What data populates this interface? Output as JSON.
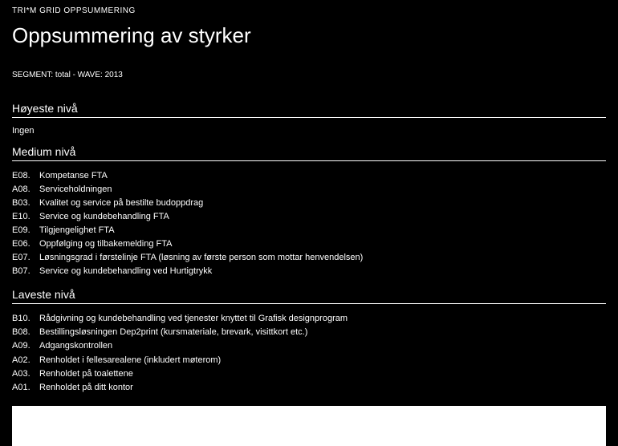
{
  "kicker": "TRI*M GRID OPPSUMMERING",
  "title": "Oppsummering av styrker",
  "segment": "SEGMENT: total - WAVE: 2013",
  "sections": {
    "high": {
      "heading": "Høyeste nivå",
      "none": "Ingen"
    },
    "medium": {
      "heading": "Medium nivå",
      "items": [
        {
          "code": "E08",
          "label": "Kompetanse FTA"
        },
        {
          "code": "A08",
          "label": "Serviceholdningen"
        },
        {
          "code": "B03",
          "label": "Kvalitet og service på bestilte budoppdrag"
        },
        {
          "code": "E10",
          "label": "Service og kundebehandling FTA"
        },
        {
          "code": "E09",
          "label": "Tilgjengelighet FTA"
        },
        {
          "code": "E06",
          "label": "Oppfølging og tilbakemelding FTA"
        },
        {
          "code": "E07",
          "label": "Løsningsgrad i førstelinje FTA (løsning av første person som mottar henvendelsen)"
        },
        {
          "code": "B07",
          "label": "Service og kundebehandling ved Hurtigtrykk"
        }
      ]
    },
    "low": {
      "heading": "Laveste nivå",
      "items": [
        {
          "code": "B10",
          "label": "Rådgivning og kundebehandling ved tjenester knyttet til Grafisk designprogram"
        },
        {
          "code": "B08",
          "label": "Bestillingsløsningen Dep2print (kursmateriale, brevark, visittkort etc.)"
        },
        {
          "code": "A09",
          "label": "Adgangskontrollen"
        },
        {
          "code": "A02",
          "label": "Renholdet i fellesarealene (inkludert møterom)"
        },
        {
          "code": "A03",
          "label": "Renholdet på toalettene"
        },
        {
          "code": "A01",
          "label": "Renholdet på ditt kontor"
        }
      ]
    }
  }
}
